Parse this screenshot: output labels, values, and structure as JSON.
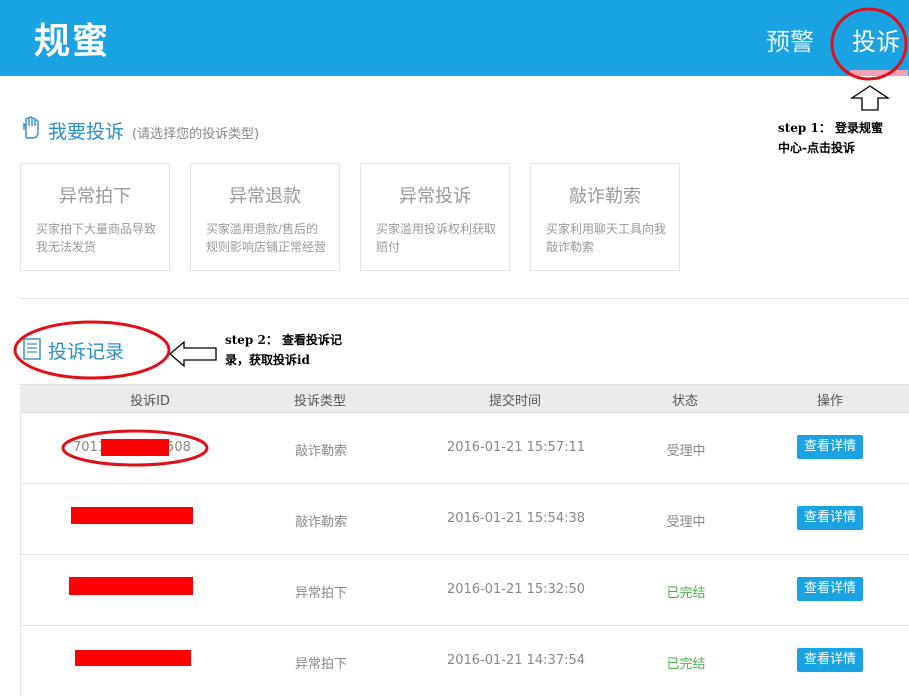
{
  "header": {
    "brand": "规蜜",
    "nav_warn": "预警",
    "nav_complain": "投诉"
  },
  "complain_section": {
    "title": "我要投诉",
    "subtitle": "(请选择您的投诉类型)"
  },
  "cards": [
    {
      "title": "异常拍下",
      "desc": "买家拍下大量商品导致我无法发货"
    },
    {
      "title": "异常退款",
      "desc": "买家滥用退款/售后的规则影响店铺正常经营"
    },
    {
      "title": "异常投诉",
      "desc": "买家滥用投诉权利获取赔付"
    },
    {
      "title": "敲诈勒索",
      "desc": "买家利用聊天工具向我敲诈勒索"
    }
  ],
  "records_section": {
    "title": "投诉记录"
  },
  "table": {
    "headers": [
      "投诉ID",
      "投诉类型",
      "提交时间",
      "状态",
      "操作"
    ],
    "rows": [
      {
        "id_prefix": "7011",
        "id_suffix": "508",
        "type": "敲诈勒索",
        "time": "2016-01-21 15:57:11",
        "status": "受理中",
        "action": "查看详情"
      },
      {
        "type": "敲诈勒索",
        "time": "2016-01-21 15:54:38",
        "status": "受理中",
        "action": "查看详情"
      },
      {
        "type": "异常拍下",
        "time": "2016-01-21 15:32:50",
        "status": "已完结",
        "action": "查看详情"
      },
      {
        "type": "异常拍下",
        "time": "2016-01-21 14:37:54",
        "status": "已完结",
        "action": "查看详情"
      }
    ]
  },
  "annotations": {
    "step1_line1": "step 1： 登录规蜜",
    "step1_line2": "中心-点击投诉",
    "step2_line1": "step 2： 查看投诉记",
    "step2_line2": "录，获取投诉id"
  },
  "colors": {
    "accent": "#1aa3e3",
    "annotation_red": "#e0101a",
    "redaction": "#ff0000",
    "done_green": "#4caf50"
  }
}
